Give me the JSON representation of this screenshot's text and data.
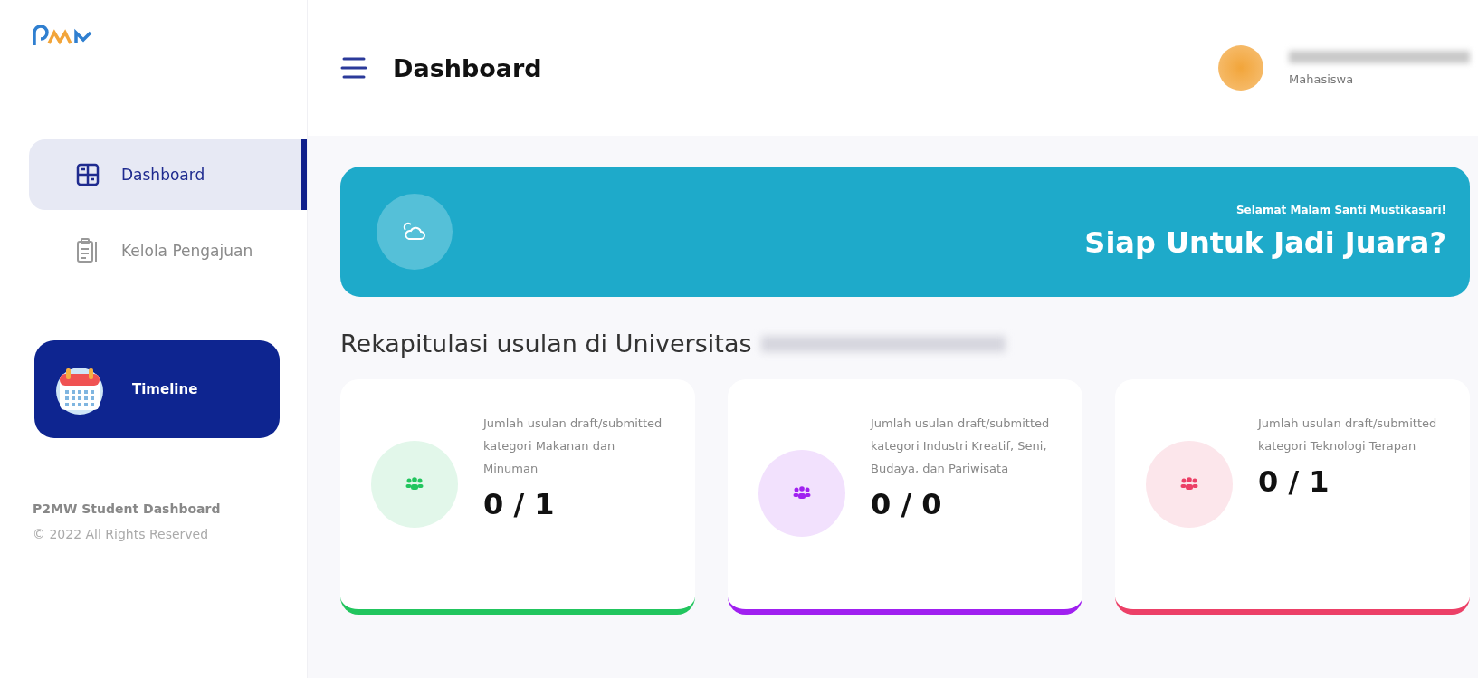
{
  "header": {
    "title": "Dashboard",
    "user_role": "Mahasiswa"
  },
  "sidebar": {
    "items": [
      {
        "label": "Dashboard",
        "selected": true,
        "kind": "dashboard"
      },
      {
        "label": "Kelola Pengajuan",
        "selected": false,
        "kind": "clipboard"
      }
    ],
    "timeline": {
      "label": "Timeline"
    },
    "footer": {
      "title": "P2MW Student Dashboard",
      "copyright": "© 2022 All Rights Reserved"
    }
  },
  "banner": {
    "greeting": "Selamat Malam Santi Mustikasari!",
    "headline": "Siap Untuk Jadi Juara?"
  },
  "section_title": "Rekapitulasi usulan di Universitas",
  "cards": [
    {
      "description": "Jumlah usulan draft/submitted kategori Makanan dan Minuman",
      "count": "0 / 1",
      "color": "#22c55e"
    },
    {
      "description": "Jumlah usulan draft/submitted kategori Industri Kreatif, Seni, Budaya, dan Pariwisata",
      "count": "0 / 0",
      "color": "#a020f0"
    },
    {
      "description": "Jumlah usulan draft/submitted kategori Teknologi Terapan",
      "count": "0 / 1",
      "color": "#ec4067"
    }
  ]
}
